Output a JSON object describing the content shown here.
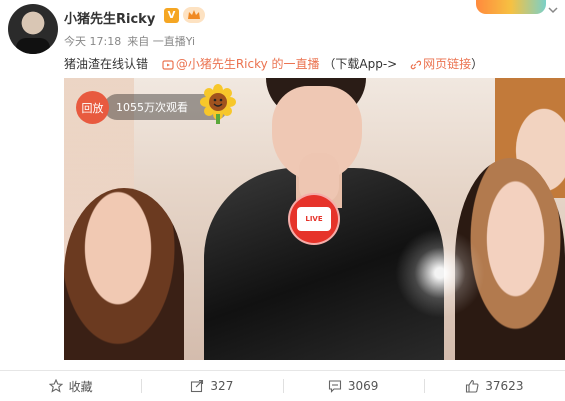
{
  "header": {
    "username": "小猪先生Ricky",
    "v_badge": "V",
    "timestamp": "今天 17:18",
    "source": "来自 一直播Yi"
  },
  "post": {
    "text": "猪油渣在线认错",
    "live_link": "@小猪先生Ricky 的一直播",
    "download": "（下载App->",
    "web_link": "网页链接",
    "close_paren": "）"
  },
  "video": {
    "replay_label": "回放",
    "views": "1055万次观看",
    "live_label": "LIVE"
  },
  "actions": {
    "favorite": "收藏",
    "repost": "327",
    "comment": "3069",
    "like": "37623"
  },
  "colors": {
    "accent": "#eb7350",
    "live_red": "#e6332a",
    "replay_red": "#e85a3f"
  }
}
